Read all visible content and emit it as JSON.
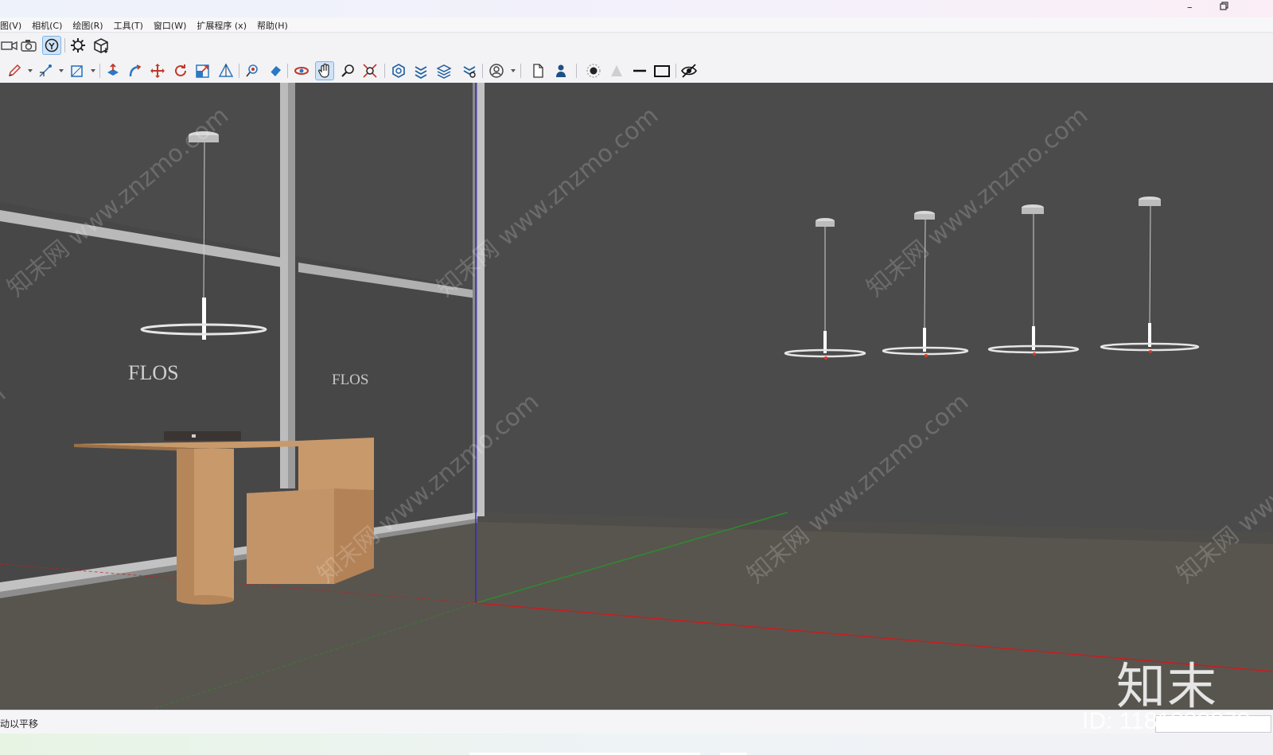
{
  "window": {
    "minimize_icon": "minimize-icon",
    "restore_icon": "restore-icon"
  },
  "menu": {
    "items": [
      "图(V)",
      "相机(C)",
      "绘图(R)",
      "工具(T)",
      "窗口(W)",
      "扩展程序 (x)",
      "帮助(H)"
    ]
  },
  "toolbar1": {
    "icons": [
      "camera-video-icon",
      "camera-photo-icon",
      "orbit-icon",
      "gear-icon",
      "cube-export-icon"
    ],
    "active": "orbit-icon"
  },
  "toolbar2": {
    "icons": [
      "pencil-icon",
      "line-dropdown-icon",
      "rectangle-icon",
      "push-pull-icon",
      "follow-me-icon",
      "move-icon",
      "rotate-icon",
      "scale-icon",
      "tape-measure-icon",
      "paint-bucket-icon",
      "eraser-icon",
      "orbit-tool-icon",
      "pan-icon",
      "zoom-icon",
      "zoom-extents-icon",
      "components-icon",
      "layers-icon",
      "tags-icon",
      "outliner-icon",
      "account-icon",
      "new-file-icon",
      "user-icon",
      "shadow-icon",
      "fog-icon",
      "line-style-icon",
      "frame-icon",
      "hide-icon"
    ],
    "active": "pan-icon"
  },
  "viewport": {
    "labels": [
      "FLOS",
      "FLOS"
    ],
    "watermark_text": "知末网 www.znzmo.com",
    "colors": {
      "background": "#4b4b4b",
      "floor": "#58554f",
      "wood": "#c8996a",
      "axis_red": "#c81d1d",
      "axis_green": "#2d8a2d",
      "axis_blue": "#2a2acc",
      "lamp": "#e6e6e6",
      "frame": "#b9b9b9"
    }
  },
  "status": {
    "text": "动以平移"
  },
  "watermark": {
    "logo": "知末",
    "id": "ID: 1181390072"
  }
}
